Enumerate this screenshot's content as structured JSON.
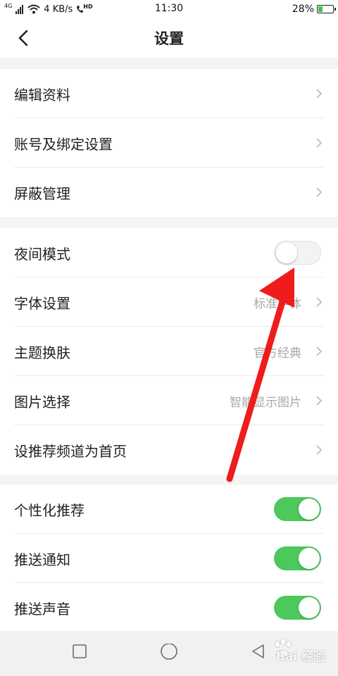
{
  "status_bar": {
    "network": "4G",
    "speed": "4 KB/s",
    "call_badge": "HD",
    "time": "11:30",
    "battery_percent": "28%",
    "battery_level": 0.28
  },
  "header": {
    "title": "设置"
  },
  "groups": [
    {
      "items": [
        {
          "label": "编辑资料"
        },
        {
          "label": "账号及绑定设置"
        },
        {
          "label": "屏蔽管理"
        }
      ]
    },
    {
      "items": [
        {
          "label": "夜间模式",
          "toggle": false
        },
        {
          "label": "字体设置",
          "value": "标准字体"
        },
        {
          "label": "主题换肤",
          "value": "官方经典"
        },
        {
          "label": "图片选择",
          "value": "智能显示图片"
        },
        {
          "label": "设推荐频道为首页"
        }
      ]
    },
    {
      "items": [
        {
          "label": "个性化推荐",
          "toggle": true
        },
        {
          "label": "推送通知",
          "toggle": true
        },
        {
          "label": "推送声音",
          "toggle": true
        }
      ]
    }
  ],
  "watermark": "Bai 经验",
  "colors": {
    "toggle_on": "#4cc85c",
    "annotation_arrow": "#ee1c1c"
  }
}
